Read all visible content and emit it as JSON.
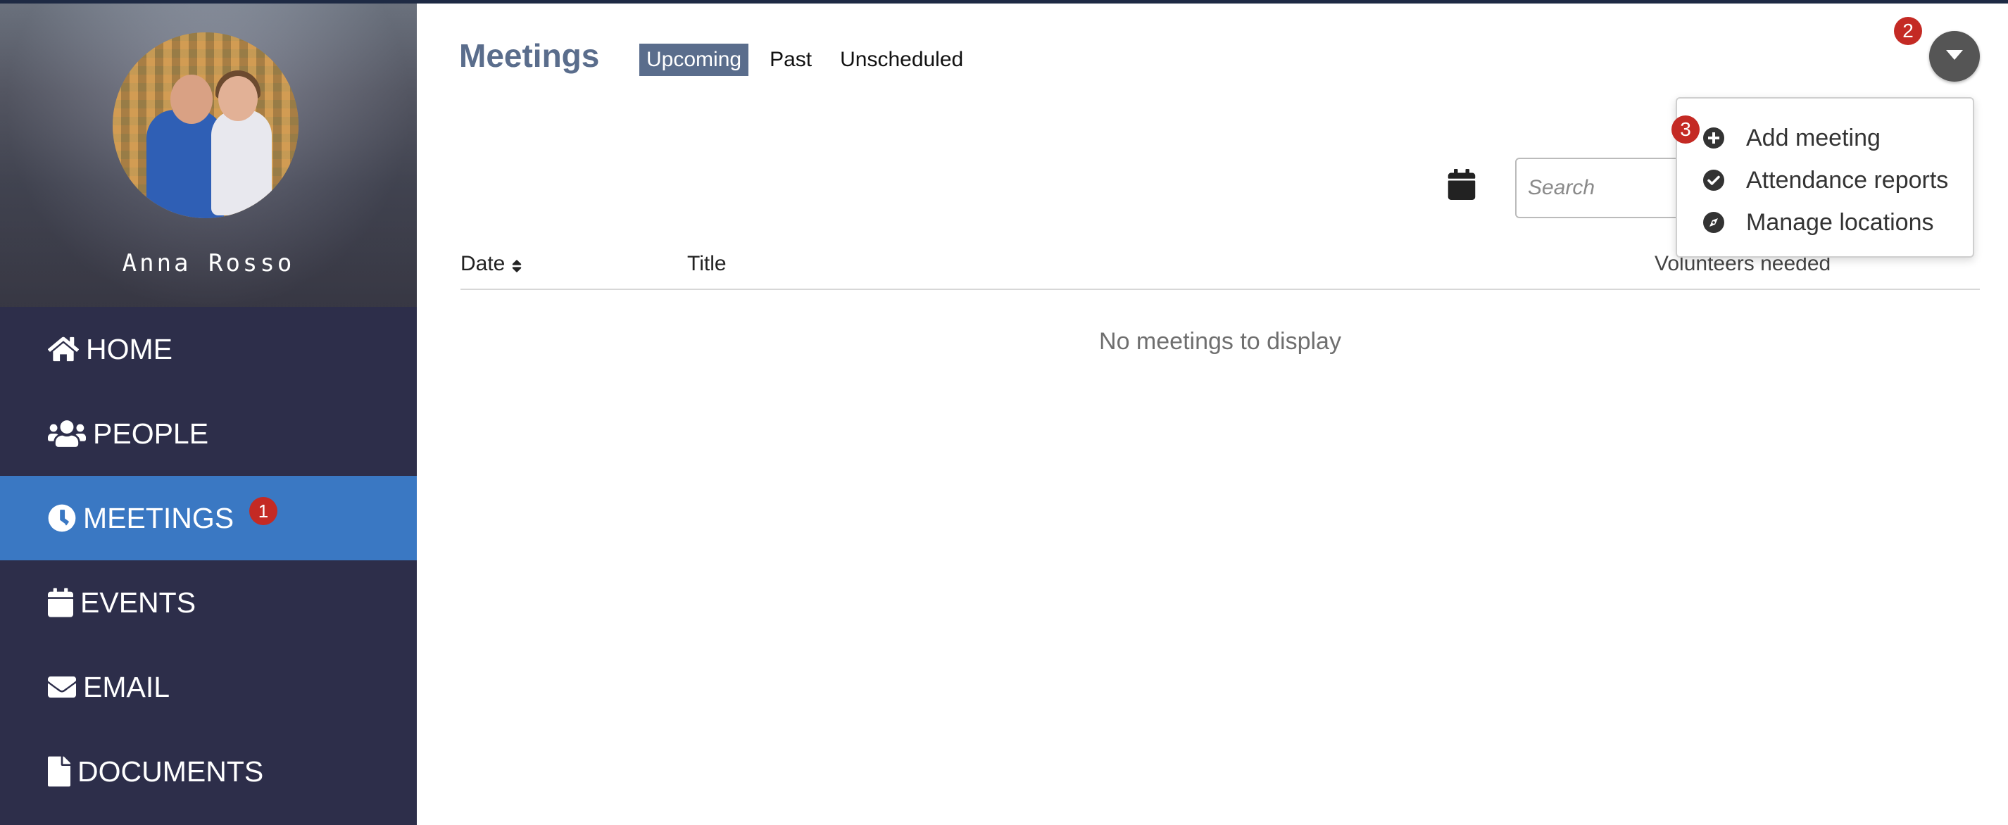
{
  "profile": {
    "name": "Anna Rosso"
  },
  "sidebar": {
    "items": [
      {
        "label": "HOME",
        "icon": "home-icon"
      },
      {
        "label": "PEOPLE",
        "icon": "people-icon"
      },
      {
        "label": "MEETINGS",
        "icon": "clock-icon",
        "active": true,
        "badge": "1"
      },
      {
        "label": "EVENTS",
        "icon": "calendar-icon"
      },
      {
        "label": "EMAIL",
        "icon": "envelope-icon"
      },
      {
        "label": "DOCUMENTS",
        "icon": "document-icon"
      }
    ]
  },
  "header": {
    "title": "Meetings",
    "tabs": [
      {
        "label": "Upcoming",
        "active": true
      },
      {
        "label": "Past"
      },
      {
        "label": "Unscheduled"
      }
    ]
  },
  "search": {
    "placeholder": "Search"
  },
  "table": {
    "columns": [
      "Date",
      "Title",
      "Volunteers needed"
    ],
    "empty_message": "No meetings to display"
  },
  "actions_menu": {
    "badge": "2",
    "item_badge": "3",
    "items": [
      {
        "label": "Add meeting",
        "icon": "plus-circle-icon"
      },
      {
        "label": "Attendance reports",
        "icon": "check-circle-icon"
      },
      {
        "label": "Manage locations",
        "icon": "compass-icon"
      }
    ]
  },
  "colors": {
    "sidebar_bg": "#2d2e4a",
    "active_nav": "#3a78c3",
    "title": "#5a6d8c",
    "badge": "#c42a24"
  }
}
